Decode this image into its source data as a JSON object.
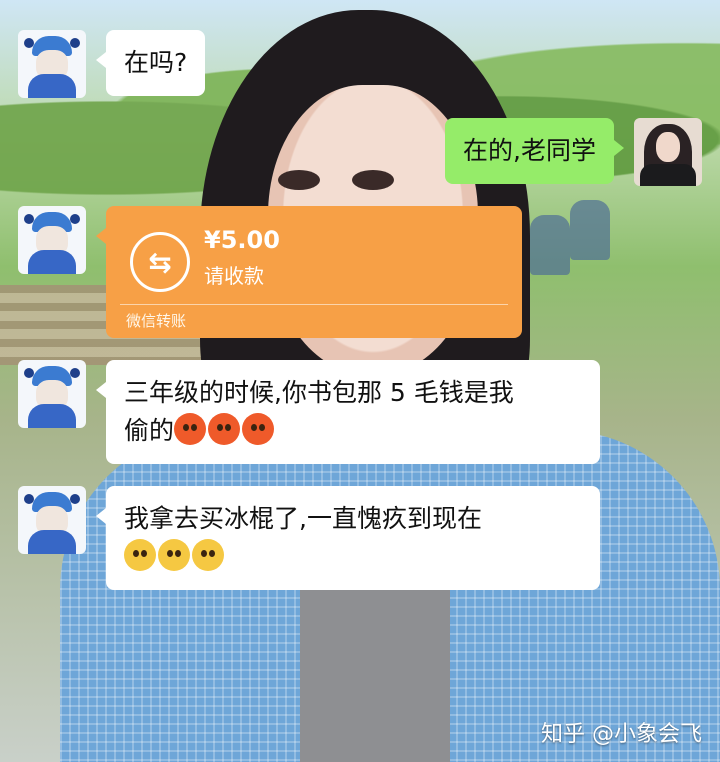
{
  "messages": [
    {
      "side": "left",
      "avatar": "boy-avatar",
      "text": "在吗?"
    },
    {
      "side": "right",
      "avatar": "girl-avatar",
      "text": "在的,老同学"
    },
    {
      "side": "left",
      "avatar": "boy-avatar",
      "type": "transfer",
      "transfer": {
        "icon": "transfer-arrows-icon",
        "amount": "¥5.00",
        "status": "请收款",
        "label": "微信转账"
      }
    },
    {
      "side": "left",
      "avatar": "boy-avatar",
      "text_line1": "三年级的时候,你书包那 5 毛钱是我",
      "text_line2": "偷的",
      "emojis": [
        "angry-face-icon",
        "angry-face-icon",
        "angry-face-icon"
      ]
    },
    {
      "side": "left",
      "avatar": "boy-avatar",
      "text_line1": "我拿去买冰棍了,一直愧疚到现在",
      "emojis": [
        "pleading-face-icon",
        "pleading-face-icon",
        "pleading-face-icon"
      ]
    }
  ],
  "watermark": "知乎 @小象会飞",
  "colors": {
    "green_bubble": "#95ec69",
    "transfer_orange": "#f7a046",
    "white_bubble": "#ffffff"
  }
}
